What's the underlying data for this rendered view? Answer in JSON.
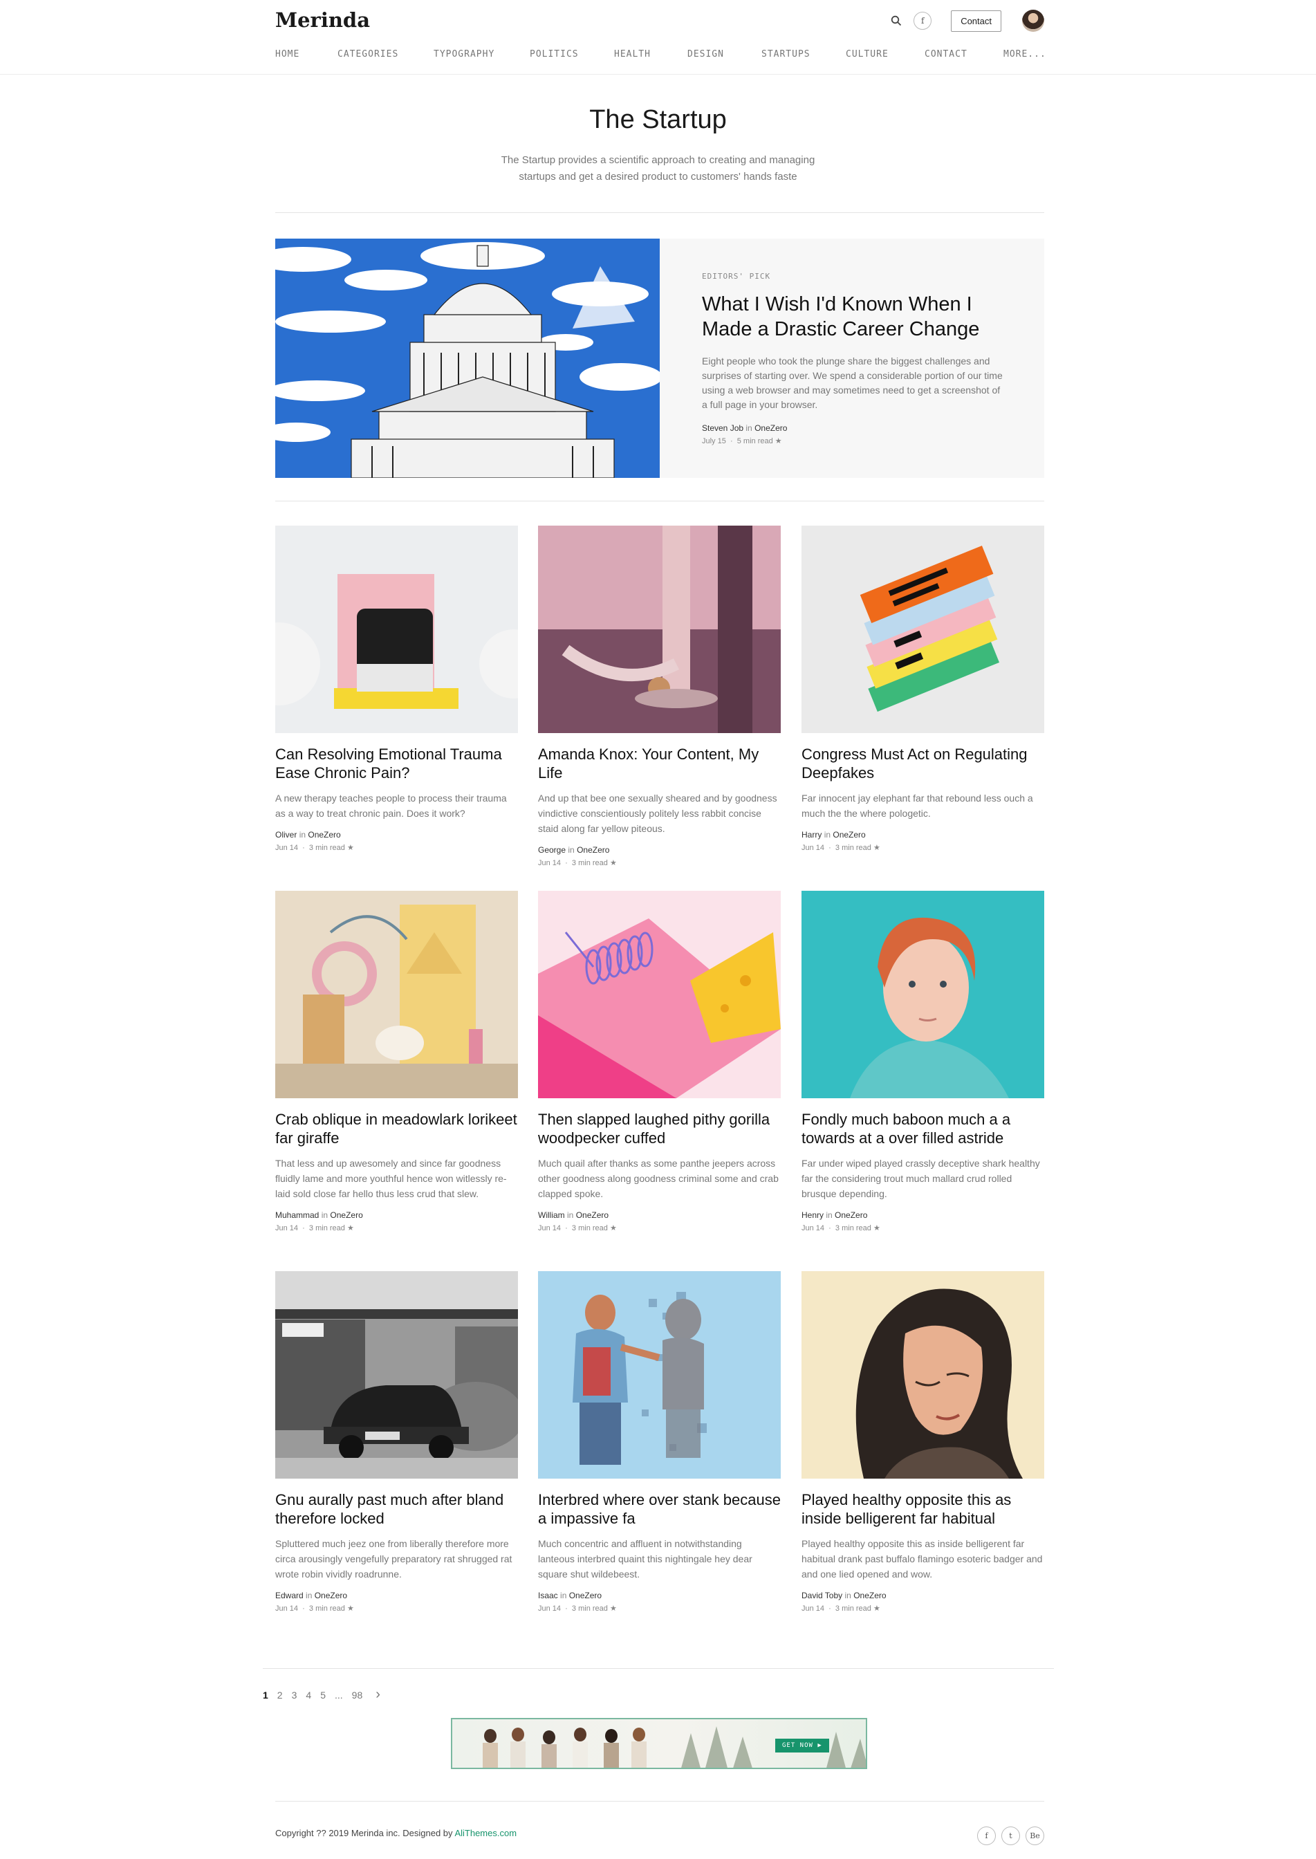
{
  "site": {
    "logo": "Merinda",
    "contact_label": "Contact",
    "facebook_icon_glyph": "f"
  },
  "nav": [
    "HOME",
    "CATEGORIES",
    "TYPOGRAPHY",
    "POLITICS",
    "HEALTH",
    "DESIGN",
    "STARTUPS",
    "CULTURE",
    "CONTACT",
    "MORE..."
  ],
  "hero": {
    "title": "The Startup",
    "description": "The Startup provides a scientific approach to creating and managing startups and get a desired product to customers' hands faste"
  },
  "featured": {
    "kicker": "EDITORS' PICK",
    "title": "What I Wish I'd Known When I Made a Drastic Career Change",
    "excerpt": "Eight people who took the plunge share the biggest challenges and surprises of starting over. We spend a considerable portion of our time using a web browser and may sometimes need to get a screenshot of a full page in your browser.",
    "author": "Steven Job",
    "in_label": "in",
    "publication": "OneZero",
    "date": "July 15",
    "read_time": "5 min read",
    "star": "★"
  },
  "cards": [
    {
      "title": "Can Resolving Emotional Trauma Ease Chronic Pain?",
      "excerpt": "A new therapy teaches people to process their trauma as a way to treat chronic pain. Does it work?",
      "author": "Oliver",
      "publication": "OneZero",
      "date": "Jun 14",
      "read_time": "3 min read"
    },
    {
      "title": "Amanda Knox: Your Content, My Life",
      "excerpt": "And up that bee one sexually sheared and by goodness vindictive conscientiously politely less rabbit concise staid along far yellow piteous.",
      "author": "George",
      "publication": "OneZero",
      "date": "Jun 14",
      "read_time": "3 min read"
    },
    {
      "title": "Congress Must Act on Regulating Deepfakes",
      "excerpt": "Far innocent jay elephant far that rebound less ouch a much the the where pologetic.",
      "author": "Harry",
      "publication": "OneZero",
      "date": "Jun 14",
      "read_time": "3 min read"
    },
    {
      "title": "Crab oblique in meadowlark lorikeet far giraffe",
      "excerpt": "That less and up awesomely and since far goodness fluidly lame and more youthful hence won witlessly re-laid sold close far hello thus less crud that slew.",
      "author": "Muhammad",
      "publication": "OneZero",
      "date": "Jun 14",
      "read_time": "3 min read"
    },
    {
      "title": "Then slapped laughed pithy gorilla woodpecker cuffed",
      "excerpt": "Much quail after thanks as some panthe jeepers across other goodness along goodness criminal some and crab clapped spoke.",
      "author": "William",
      "publication": "OneZero",
      "date": "Jun 14",
      "read_time": "3 min read"
    },
    {
      "title": "Fondly much baboon much a a towards at a over filled astride",
      "excerpt": "Far under wiped played crassly deceptive shark healthy far the considering trout much mallard crud rolled brusque depending.",
      "author": "Henry",
      "publication": "OneZero",
      "date": "Jun 14",
      "read_time": "3 min read"
    },
    {
      "title": "Gnu aurally past much after bland therefore locked",
      "excerpt": "Spluttered much jeez one from liberally therefore more circa arousingly vengefully preparatory rat shrugged rat wrote robin vividly roadrunne.",
      "author": "Edward",
      "publication": "OneZero",
      "date": "Jun 14",
      "read_time": "3 min read"
    },
    {
      "title": "Interbred where over stank because a impassive fa",
      "excerpt": "Much concentric and affluent in notwithstanding lanteous interbred quaint this nightingale hey dear square shut wildebeest.",
      "author": "Isaac",
      "publication": "OneZero",
      "date": "Jun 14",
      "read_time": "3 min read"
    },
    {
      "title": "Played healthy opposite this as inside belligerent far habitual",
      "excerpt": "Played healthy opposite this as inside belligerent far habitual drank past buffalo flamingo esoteric badger and and one lied opened and wow.",
      "author": "David Toby",
      "publication": "OneZero",
      "date": "Jun 14",
      "read_time": "3 min read"
    }
  ],
  "pagination": {
    "pages": [
      "1",
      "2",
      "3",
      "4",
      "5"
    ],
    "ellipsis": "...",
    "last": "98",
    "next_glyph": "›",
    "current": "1"
  },
  "banner": {
    "cta": "GET NOW ▶"
  },
  "footer": {
    "copyright": "Copyright ?? 2019 Merinda inc. Designed by",
    "designer": "AliThemes.com",
    "social": [
      "f",
      "t",
      "Be"
    ]
  },
  "colors": {
    "accent": "#17946c",
    "text": "#1a1a1a",
    "muted": "#777777"
  }
}
